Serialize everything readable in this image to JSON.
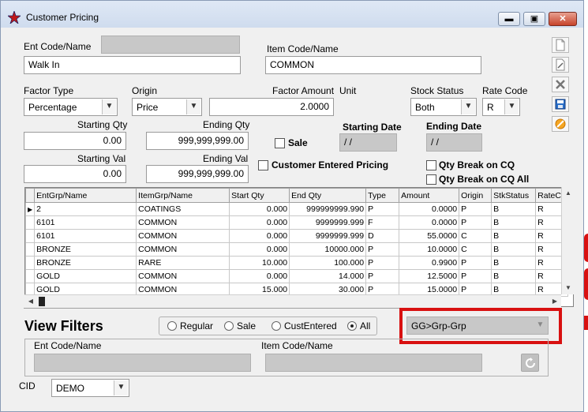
{
  "window": {
    "title": "Customer Pricing"
  },
  "titlebar_buttons": {
    "minimize": "▬",
    "restore": "▣",
    "close": "✕"
  },
  "ent": {
    "label": "Ent Code/Name",
    "code": "",
    "name": "Walk In"
  },
  "item": {
    "label": "Item Code/Name",
    "name": "COMMON"
  },
  "factor_type": {
    "label": "Factor Type",
    "value": "Percentage"
  },
  "origin": {
    "label": "Origin",
    "value": "Price"
  },
  "factor_amount": {
    "label": "Factor Amount",
    "value": "2.0000"
  },
  "unit": {
    "label": "Unit"
  },
  "stock_status": {
    "label": "Stock Status",
    "value": "Both"
  },
  "rate_code": {
    "label": "Rate Code",
    "value": "R"
  },
  "starting_qty": {
    "label": "Starting Qty",
    "value": "0.00"
  },
  "ending_qty": {
    "label": "Ending Qty",
    "value": "999,999,999.00"
  },
  "starting_val": {
    "label": "Starting Val",
    "value": "0.00"
  },
  "ending_val": {
    "label": "Ending Val",
    "value": "999,999,999.00"
  },
  "sale": {
    "label": "Sale"
  },
  "starting_date": {
    "label": "Starting Date",
    "value": " / /"
  },
  "ending_date": {
    "label": "Ending Date",
    "value": " / /"
  },
  "customer_entered_pricing": {
    "label": "Customer Entered Pricing"
  },
  "qty_break_cq": {
    "label": "Qty Break on CQ"
  },
  "qty_break_cq_all": {
    "label": "Qty Break on CQ All"
  },
  "toolbar": {
    "new_icon": "new-document-icon",
    "edit_icon": "edit-document-icon",
    "delete_icon": "delete-x-icon",
    "save_icon": "save-disk-icon",
    "cancel_icon": "cancel-circle-icon"
  },
  "grid": {
    "columns": [
      "EntGrp/Name",
      "ItemGrp/Name",
      "Start Qty",
      "End Qty",
      "Type",
      "Amount",
      "Origin",
      "StkStatus",
      "RateCo"
    ],
    "rows": [
      [
        "2",
        "COATINGS",
        "0.000",
        "999999999.990",
        "P",
        "0.0000",
        "P",
        "B",
        "R"
      ],
      [
        "6101",
        "COMMON",
        "0.000",
        "9999999.999",
        "F",
        "0.0000",
        "P",
        "B",
        "R"
      ],
      [
        "6101",
        "COMMON",
        "0.000",
        "9999999.999",
        "D",
        "55.0000",
        "C",
        "B",
        "R"
      ],
      [
        "BRONZE",
        "COMMON",
        "0.000",
        "10000.000",
        "P",
        "10.0000",
        "C",
        "B",
        "R"
      ],
      [
        "BRONZE",
        "RARE",
        "10.000",
        "100.000",
        "P",
        "0.9900",
        "P",
        "B",
        "R"
      ],
      [
        "GOLD",
        "COMMON",
        "0.000",
        "14.000",
        "P",
        "12.5000",
        "P",
        "B",
        "R"
      ],
      [
        "GOLD",
        "COMMON",
        "15.000",
        "30.000",
        "P",
        "15.0000",
        "P",
        "B",
        "R"
      ]
    ]
  },
  "view_filters": {
    "title": "View Filters",
    "radios": [
      "Regular",
      "Sale",
      "CustEntered",
      "All"
    ],
    "selected": "All",
    "group_select": "GG>Grp-Grp",
    "ent_label": "Ent Code/Name",
    "item_label": "Item Code/Name"
  },
  "cid": {
    "label": "CID",
    "value": "DEMO"
  }
}
